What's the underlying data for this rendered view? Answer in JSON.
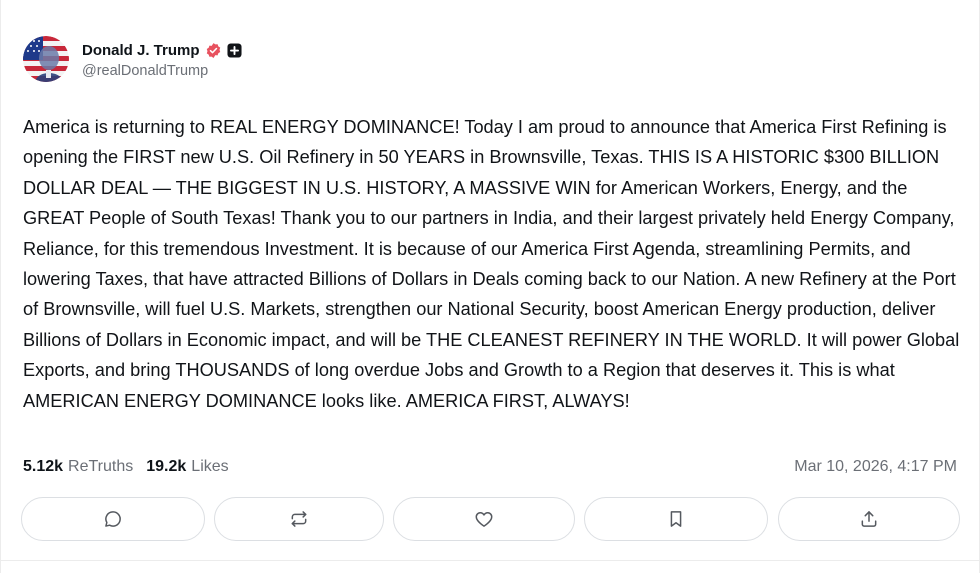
{
  "author": {
    "display_name": "Donald J. Trump",
    "handle": "@realDonaldTrump",
    "avatar_icon": "avatar-flag-portrait",
    "verified_icon": "verified-badge-icon",
    "verified_color": "#e8525f",
    "badge_icon": "plus-badge-icon"
  },
  "post": {
    "text": "America is returning to REAL ENERGY DOMINANCE! Today I am proud to announce that America First Refining is opening the FIRST new U.S. Oil Refinery in 50 YEARS in Brownsville, Texas. THIS IS A HISTORIC $300 BILLION DOLLAR DEAL — THE BIGGEST IN U.S. HISTORY, A MASSIVE WIN for American Workers, Energy, and the GREAT People of South Texas! Thank you to our partners in India, and their largest privately held Energy Company, Reliance, for this tremendous Investment. It is because of our America First Agenda, streamlining Permits, and lowering Taxes, that have attracted Billions of Dollars in Deals coming back to our Nation. A new Refinery at the Port of Brownsville, will fuel U.S. Markets, strengthen our National Security, boost American Energy production, deliver Billions of Dollars in Economic impact, and will be THE CLEANEST REFINERY IN THE WORLD. It will power Global Exports, and bring THOUSANDS of long overdue Jobs and Growth to a Region that deserves it. This is what AMERICAN ENERGY DOMINANCE looks like. AMERICA FIRST, ALWAYS!",
    "retruths_count": "5.12k",
    "retruths_label": "ReTruths",
    "likes_count": "19.2k",
    "likes_label": "Likes",
    "timestamp": "Mar 10, 2026, 4:17 PM"
  },
  "actions": [
    {
      "name": "reply",
      "icon": "comment-icon"
    },
    {
      "name": "retruth",
      "icon": "retruth-icon"
    },
    {
      "name": "like",
      "icon": "heart-icon"
    },
    {
      "name": "bookmark",
      "icon": "bookmark-icon"
    },
    {
      "name": "share",
      "icon": "share-icon"
    }
  ],
  "colors": {
    "text": "#0f1419",
    "muted": "#6b6f76",
    "border": "#dcdfe3"
  }
}
